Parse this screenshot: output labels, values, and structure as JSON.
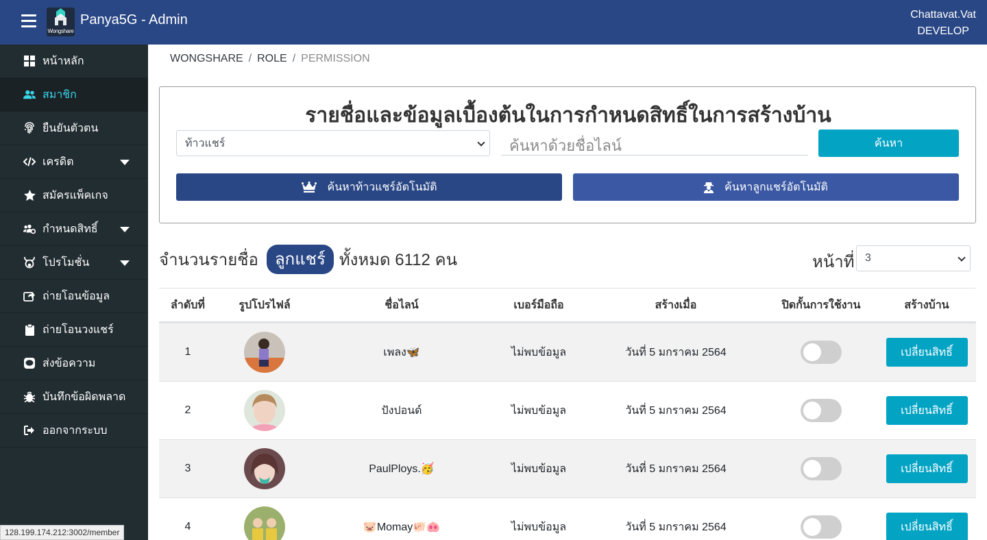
{
  "header": {
    "app_title": "Panya5G - Admin",
    "logo_text": "Wongshare",
    "user_name": "Chattavat.Vat",
    "user_role": "DEVELOP"
  },
  "sidebar": {
    "items": [
      {
        "label": "หน้าหลัก",
        "icon": "grid-icon"
      },
      {
        "label": "สมาชิก",
        "icon": "users-icon",
        "active": true
      },
      {
        "label": "ยืนยันตัวตน",
        "icon": "fingerprint-icon"
      },
      {
        "label": "เครดิต",
        "icon": "code-icon",
        "dropdown": true
      },
      {
        "label": "สมัครแพ็คเกจ",
        "icon": "star-icon"
      },
      {
        "label": "กำหนดสิทธิ์",
        "icon": "users-cog-icon",
        "dropdown": true
      },
      {
        "label": "โปรโมชั่น",
        "icon": "bull-icon",
        "dropdown": true
      },
      {
        "label": "ถ่ายโอนข้อมูล",
        "icon": "share-square-icon"
      },
      {
        "label": "ถ่ายโอนวงแชร์",
        "icon": "clipboard-icon"
      },
      {
        "label": "ส่งข้อความ",
        "icon": "line-chat-icon"
      },
      {
        "label": "บันทึกข้อผิดพลาด",
        "icon": "bug-icon"
      },
      {
        "label": "ออกจากระบบ",
        "icon": "sign-out-icon"
      }
    ]
  },
  "status_url": "128.199.174.212:3002/member",
  "breadcrumb": {
    "items": [
      "WONGSHARE",
      "ROLE"
    ],
    "current": "PERMISSION",
    "separator": "/"
  },
  "search": {
    "title": "รายชื่อและข้อมูลเบื้องต้นในการกำหนดสิทธิ์ในการสร้างบ้าน",
    "select_value": "ท้าวแชร์",
    "input_placeholder": "ค้นหาด้วยชื่อไลน์",
    "search_button": "ค้นหา",
    "auto_host_button": "ค้นหาท้าวแชร์อัตโนมัติ",
    "auto_member_button": "ค้นหาลูกแชร์อัตโนมัติ"
  },
  "summary": {
    "prefix": "จำนวนรายชื่อ",
    "badge": "ลูกแชร์",
    "suffix": "ทั้งหมด 6112 คน",
    "page_label": "หน้าที่",
    "page_value": "3"
  },
  "table": {
    "headers": [
      "ลำดับที่",
      "รูปโปรไฟล์",
      "ชื่อไลน์",
      "เบอร์มือถือ",
      "สร้างเมื่อ",
      "ปิดกั้นการใช้งาน",
      "สร้างบ้าน"
    ],
    "rows": [
      {
        "index": "1",
        "line_name": "เพลง🦋",
        "phone": "ไม่พบข้อมูล",
        "created": "วันที่ 5 มกราคม 2564",
        "blocked": false,
        "action": "เปลี่ยนสิทธิ์"
      },
      {
        "index": "2",
        "line_name": "ปังปอนด์",
        "phone": "ไม่พบข้อมูล",
        "created": "วันที่ 5 มกราคม 2564",
        "blocked": false,
        "action": "เปลี่ยนสิทธิ์"
      },
      {
        "index": "3",
        "line_name": "PaulPloys.🥳",
        "phone": "ไม่พบข้อมูล",
        "created": "วันที่ 5 มกราคม 2564",
        "blocked": false,
        "action": "เปลี่ยนสิทธิ์"
      },
      {
        "index": "4",
        "line_name": "🐷Momay🐖🐽",
        "phone": "ไม่พบข้อมูล",
        "created": "วันที่ 5 มกราคม 2564",
        "blocked": false,
        "action": "เปลี่ยนสิทธิ์"
      }
    ]
  },
  "colors": {
    "header_bg": "#2a4785",
    "sidebar_bg": "#222d32",
    "sidebar_active_text": "#3bd3e6",
    "primary_button": "#03a3c4",
    "host_button": "#2a4785",
    "member_button": "#3a58a3"
  }
}
